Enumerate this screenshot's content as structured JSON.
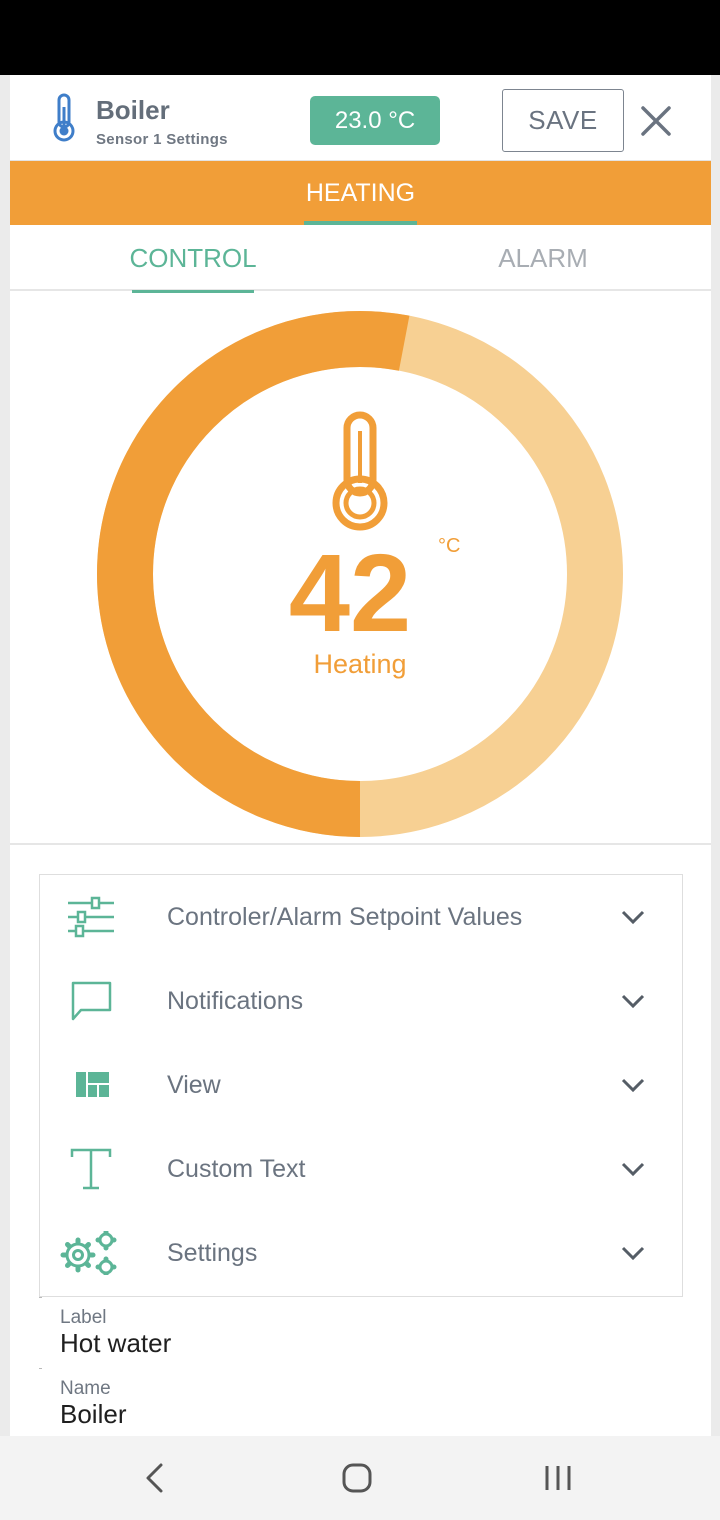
{
  "header": {
    "title": "Boiler",
    "subtitle": "Sensor 1 Settings",
    "current_temp": "23.0 °C",
    "save_label": "SAVE",
    "title_icon": "thermometer-icon",
    "close_icon": "close-icon"
  },
  "mode_tab": {
    "label": "HEATING"
  },
  "sub_tabs": [
    {
      "label": "CONTROL",
      "active": true
    },
    {
      "label": "ALARM",
      "active": false
    }
  ],
  "gauge": {
    "value": "42",
    "unit": "°C",
    "status": "Heating",
    "level_fraction": 0.53,
    "icon": "thermometer-icon"
  },
  "accordion": [
    {
      "label": "Controler/Alarm Setpoint Values",
      "icon": "sliders-icon"
    },
    {
      "label": "Notifications",
      "icon": "chat-bubble-icon"
    },
    {
      "label": "View",
      "icon": "layout-grid-icon"
    },
    {
      "label": "Custom Text",
      "icon": "text-icon"
    },
    {
      "label": "Settings",
      "icon": "gears-icon"
    }
  ],
  "fields": {
    "label": {
      "caption": "Label",
      "value": "Hot water"
    },
    "name": {
      "caption": "Name",
      "value": "Boiler"
    }
  },
  "colors": {
    "accent_orange": "#f19e38",
    "light_orange": "#f7d093",
    "accent_green": "#5cb597",
    "icon_blue": "#3f7ec9"
  },
  "navbar": {
    "icons": [
      "back-icon",
      "home-icon",
      "recents-icon"
    ]
  }
}
